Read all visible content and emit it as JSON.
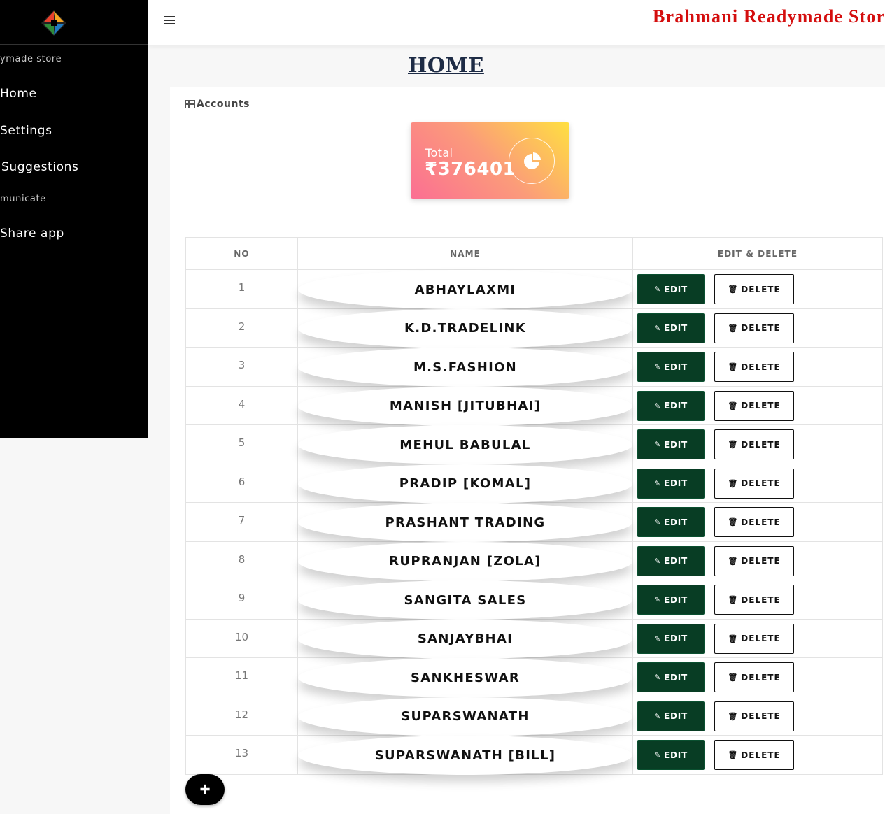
{
  "sidebar": {
    "section1": "ymade store",
    "home": "Home",
    "settings": "Settings",
    "suggestions": "Suggestions",
    "section2": "municate",
    "share": "Share app"
  },
  "header": {
    "store_title": "Brahmani Readymade Store",
    "page_title": "HOME"
  },
  "card": {
    "title": "Accounts",
    "stat_label": "Total",
    "stat_value": "₹376401"
  },
  "table": {
    "headers": {
      "no": "NO",
      "name": "NAME",
      "actions": "EDIT & DELETE"
    },
    "edit_label": "EDIT",
    "delete_label": "DELETE",
    "rows": [
      {
        "no": "1",
        "name": "ABHAYLAXMI"
      },
      {
        "no": "2",
        "name": "K.D.TRADELINK"
      },
      {
        "no": "3",
        "name": "M.S.FASHION"
      },
      {
        "no": "4",
        "name": "MANISH [JITUBHAI]"
      },
      {
        "no": "5",
        "name": "MEHUL BABULAL"
      },
      {
        "no": "6",
        "name": "PRADIP [KOMAL]"
      },
      {
        "no": "7",
        "name": "PRASHANT TRADING"
      },
      {
        "no": "8",
        "name": "RUPRANJAN [ZOLA]"
      },
      {
        "no": "9",
        "name": "SANGITA SALES"
      },
      {
        "no": "10",
        "name": "SANJAYBHAI"
      },
      {
        "no": "11",
        "name": "SANKHESWAR"
      },
      {
        "no": "12",
        "name": "SUPARSWANATH"
      },
      {
        "no": "13",
        "name": "SUPARSWANATH [BILL]"
      }
    ]
  },
  "colors": {
    "sidebar_bg": "#000000",
    "title_red": "#d40e0e",
    "edit_green": "#083d24",
    "gradient_start": "#fb6e93",
    "gradient_end": "#ffe040"
  },
  "icons": {
    "logo": "diamond-logo-icon",
    "menu": "hamburger-icon",
    "table": "table-icon",
    "stat": "pie-chart-icon",
    "edit": "edit-icon",
    "delete": "trash-icon",
    "add": "plus-icon"
  }
}
